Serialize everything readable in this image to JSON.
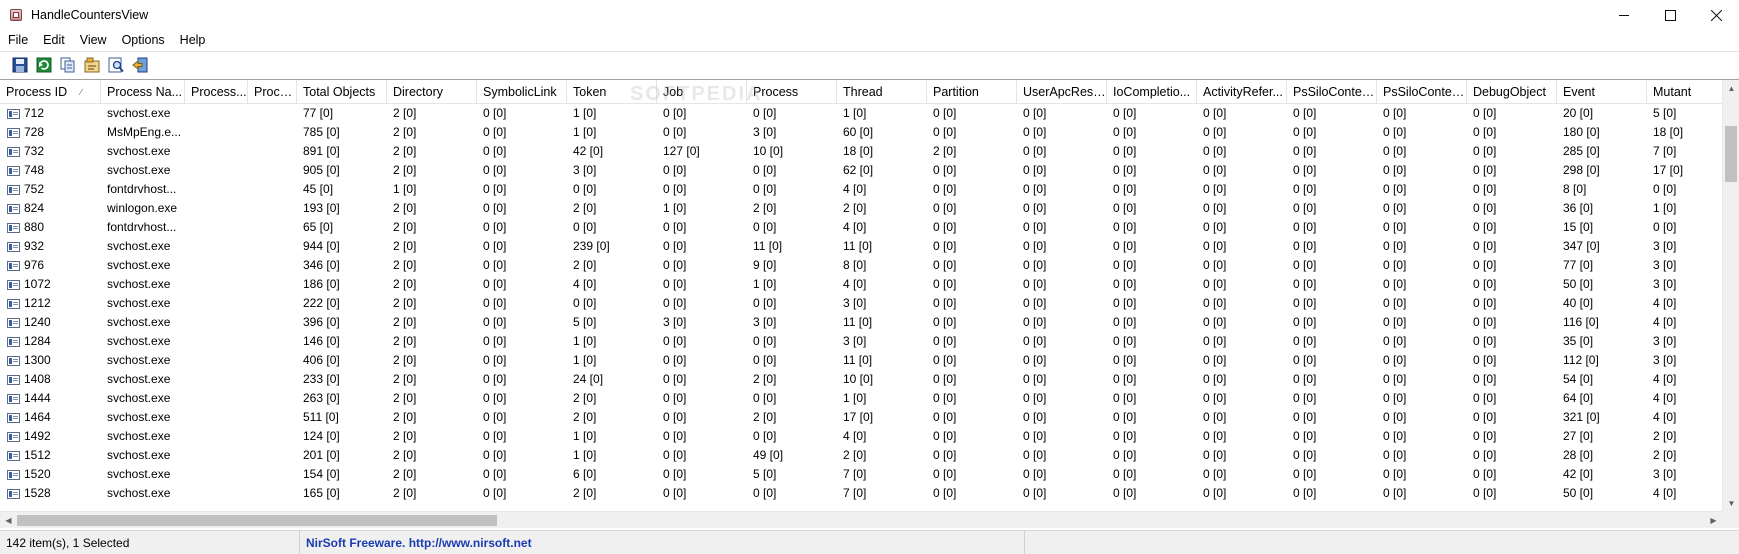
{
  "window": {
    "title": "HandleCountersView"
  },
  "menu": [
    "File",
    "Edit",
    "View",
    "Options",
    "Help"
  ],
  "colors": {
    "link": "#1a3cb0",
    "icon_blue": "#3b5f9e"
  },
  "toolbar": [
    {
      "icon": "save-icon"
    },
    {
      "icon": "refresh-icon"
    },
    {
      "icon": "copy-icon"
    },
    {
      "icon": "properties-icon"
    },
    {
      "icon": "find-icon"
    },
    {
      "icon": "exit-icon"
    }
  ],
  "columns": [
    "Process ID",
    "Process Na...",
    "Process...",
    "Proce...",
    "Total Objects",
    "Directory",
    "SymbolicLink",
    "Token",
    "Job",
    "Process",
    "Thread",
    "Partition",
    "UserApcRese...",
    "IoCompletio...",
    "ActivityRefer...",
    "PsSiloContex...",
    "PsSiloContex...",
    "DebugObject",
    "Event",
    "Mutant"
  ],
  "sort_indicator": "∕",
  "watermark": "SOFTPEDIA",
  "rows": [
    [
      "712",
      "svchost.exe",
      "",
      "",
      "77  [0]",
      "2  [0]",
      "0  [0]",
      "1  [0]",
      "0  [0]",
      "0  [0]",
      "1  [0]",
      "0  [0]",
      "0  [0]",
      "0  [0]",
      "0  [0]",
      "0  [0]",
      "0  [0]",
      "0  [0]",
      "20  [0]",
      "5  [0]"
    ],
    [
      "728",
      "MsMpEng.e...",
      "",
      "",
      "785  [0]",
      "2  [0]",
      "0  [0]",
      "1  [0]",
      "0  [0]",
      "3  [0]",
      "60  [0]",
      "0  [0]",
      "0  [0]",
      "0  [0]",
      "0  [0]",
      "0  [0]",
      "0  [0]",
      "0  [0]",
      "180  [0]",
      "18  [0]"
    ],
    [
      "732",
      "svchost.exe",
      "",
      "",
      "891  [0]",
      "2  [0]",
      "0  [0]",
      "42  [0]",
      "127  [0]",
      "10  [0]",
      "18  [0]",
      "2  [0]",
      "0  [0]",
      "0  [0]",
      "0  [0]",
      "0  [0]",
      "0  [0]",
      "0  [0]",
      "285  [0]",
      "7  [0]"
    ],
    [
      "748",
      "svchost.exe",
      "",
      "",
      "905  [0]",
      "2  [0]",
      "0  [0]",
      "3  [0]",
      "0  [0]",
      "0  [0]",
      "62  [0]",
      "0  [0]",
      "0  [0]",
      "0  [0]",
      "0  [0]",
      "0  [0]",
      "0  [0]",
      "0  [0]",
      "298  [0]",
      "17  [0]"
    ],
    [
      "752",
      "fontdrvhost...",
      "",
      "",
      "45  [0]",
      "1  [0]",
      "0  [0]",
      "0  [0]",
      "0  [0]",
      "0  [0]",
      "4  [0]",
      "0  [0]",
      "0  [0]",
      "0  [0]",
      "0  [0]",
      "0  [0]",
      "0  [0]",
      "0  [0]",
      "8  [0]",
      "0  [0]"
    ],
    [
      "824",
      "winlogon.exe",
      "",
      "",
      "193  [0]",
      "2  [0]",
      "0  [0]",
      "2  [0]",
      "1  [0]",
      "2  [0]",
      "2  [0]",
      "0  [0]",
      "0  [0]",
      "0  [0]",
      "0  [0]",
      "0  [0]",
      "0  [0]",
      "0  [0]",
      "36  [0]",
      "1  [0]"
    ],
    [
      "880",
      "fontdrvhost...",
      "",
      "",
      "65  [0]",
      "2  [0]",
      "0  [0]",
      "0  [0]",
      "0  [0]",
      "0  [0]",
      "4  [0]",
      "0  [0]",
      "0  [0]",
      "0  [0]",
      "0  [0]",
      "0  [0]",
      "0  [0]",
      "0  [0]",
      "15  [0]",
      "0  [0]"
    ],
    [
      "932",
      "svchost.exe",
      "",
      "",
      "944  [0]",
      "2  [0]",
      "0  [0]",
      "239  [0]",
      "0  [0]",
      "11  [0]",
      "11  [0]",
      "0  [0]",
      "0  [0]",
      "0  [0]",
      "0  [0]",
      "0  [0]",
      "0  [0]",
      "0  [0]",
      "347  [0]",
      "3  [0]"
    ],
    [
      "976",
      "svchost.exe",
      "",
      "",
      "346  [0]",
      "2  [0]",
      "0  [0]",
      "2  [0]",
      "0  [0]",
      "9  [0]",
      "8  [0]",
      "0  [0]",
      "0  [0]",
      "0  [0]",
      "0  [0]",
      "0  [0]",
      "0  [0]",
      "0  [0]",
      "77  [0]",
      "3  [0]"
    ],
    [
      "1072",
      "svchost.exe",
      "",
      "",
      "186  [0]",
      "2  [0]",
      "0  [0]",
      "4  [0]",
      "0  [0]",
      "1  [0]",
      "4  [0]",
      "0  [0]",
      "0  [0]",
      "0  [0]",
      "0  [0]",
      "0  [0]",
      "0  [0]",
      "0  [0]",
      "50  [0]",
      "3  [0]"
    ],
    [
      "1212",
      "svchost.exe",
      "",
      "",
      "222  [0]",
      "2  [0]",
      "0  [0]",
      "0  [0]",
      "0  [0]",
      "0  [0]",
      "3  [0]",
      "0  [0]",
      "0  [0]",
      "0  [0]",
      "0  [0]",
      "0  [0]",
      "0  [0]",
      "0  [0]",
      "40  [0]",
      "4  [0]"
    ],
    [
      "1240",
      "svchost.exe",
      "",
      "",
      "396  [0]",
      "2  [0]",
      "0  [0]",
      "5  [0]",
      "3  [0]",
      "3  [0]",
      "11  [0]",
      "0  [0]",
      "0  [0]",
      "0  [0]",
      "0  [0]",
      "0  [0]",
      "0  [0]",
      "0  [0]",
      "116  [0]",
      "4  [0]"
    ],
    [
      "1284",
      "svchost.exe",
      "",
      "",
      "146  [0]",
      "2  [0]",
      "0  [0]",
      "1  [0]",
      "0  [0]",
      "0  [0]",
      "3  [0]",
      "0  [0]",
      "0  [0]",
      "0  [0]",
      "0  [0]",
      "0  [0]",
      "0  [0]",
      "0  [0]",
      "35  [0]",
      "3  [0]"
    ],
    [
      "1300",
      "svchost.exe",
      "",
      "",
      "406  [0]",
      "2  [0]",
      "0  [0]",
      "1  [0]",
      "0  [0]",
      "0  [0]",
      "11  [0]",
      "0  [0]",
      "0  [0]",
      "0  [0]",
      "0  [0]",
      "0  [0]",
      "0  [0]",
      "0  [0]",
      "112  [0]",
      "3  [0]"
    ],
    [
      "1408",
      "svchost.exe",
      "",
      "",
      "233  [0]",
      "2  [0]",
      "0  [0]",
      "24  [0]",
      "0  [0]",
      "2  [0]",
      "10  [0]",
      "0  [0]",
      "0  [0]",
      "0  [0]",
      "0  [0]",
      "0  [0]",
      "0  [0]",
      "0  [0]",
      "54  [0]",
      "4  [0]"
    ],
    [
      "1444",
      "svchost.exe",
      "",
      "",
      "263  [0]",
      "2  [0]",
      "0  [0]",
      "2  [0]",
      "0  [0]",
      "0  [0]",
      "1  [0]",
      "0  [0]",
      "0  [0]",
      "0  [0]",
      "0  [0]",
      "0  [0]",
      "0  [0]",
      "0  [0]",
      "64  [0]",
      "4  [0]"
    ],
    [
      "1464",
      "svchost.exe",
      "",
      "",
      "511  [0]",
      "2  [0]",
      "0  [0]",
      "2  [0]",
      "0  [0]",
      "2  [0]",
      "17  [0]",
      "0  [0]",
      "0  [0]",
      "0  [0]",
      "0  [0]",
      "0  [0]",
      "0  [0]",
      "0  [0]",
      "321  [0]",
      "4  [0]"
    ],
    [
      "1492",
      "svchost.exe",
      "",
      "",
      "124  [0]",
      "2  [0]",
      "0  [0]",
      "1  [0]",
      "0  [0]",
      "0  [0]",
      "4  [0]",
      "0  [0]",
      "0  [0]",
      "0  [0]",
      "0  [0]",
      "0  [0]",
      "0  [0]",
      "0  [0]",
      "27  [0]",
      "2  [0]"
    ],
    [
      "1512",
      "svchost.exe",
      "",
      "",
      "201  [0]",
      "2  [0]",
      "0  [0]",
      "1  [0]",
      "0  [0]",
      "49  [0]",
      "2  [0]",
      "0  [0]",
      "0  [0]",
      "0  [0]",
      "0  [0]",
      "0  [0]",
      "0  [0]",
      "0  [0]",
      "28  [0]",
      "2  [0]"
    ],
    [
      "1520",
      "svchost.exe",
      "",
      "",
      "154  [0]",
      "2  [0]",
      "0  [0]",
      "6  [0]",
      "0  [0]",
      "5  [0]",
      "7  [0]",
      "0  [0]",
      "0  [0]",
      "0  [0]",
      "0  [0]",
      "0  [0]",
      "0  [0]",
      "0  [0]",
      "42  [0]",
      "3  [0]"
    ],
    [
      "1528",
      "svchost.exe",
      "",
      "",
      "165  [0]",
      "2  [0]",
      "0  [0]",
      "2  [0]",
      "0  [0]",
      "0  [0]",
      "7  [0]",
      "0  [0]",
      "0  [0]",
      "0  [0]",
      "0  [0]",
      "0  [0]",
      "0  [0]",
      "0  [0]",
      "50  [0]",
      "4  [0]"
    ]
  ],
  "status": {
    "items": "142 item(s), 1 Selected",
    "link": "NirSoft Freeware.  http://www.nirsoft.net"
  }
}
